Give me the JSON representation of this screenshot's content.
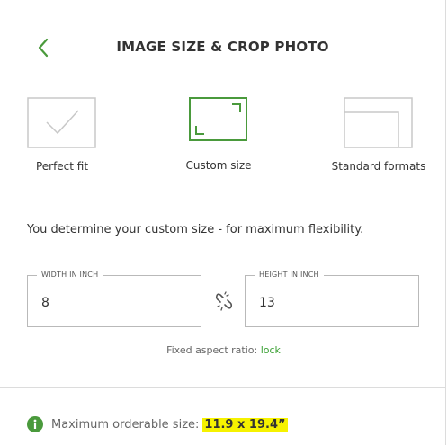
{
  "header": {
    "title": "IMAGE SIZE & CROP PHOTO"
  },
  "options": [
    {
      "label": "Perfect fit",
      "icon": "checkmark-frame-icon",
      "selected": false
    },
    {
      "label": "Custom size",
      "icon": "crop-corners-icon",
      "selected": true
    },
    {
      "label": "Standard formats",
      "icon": "nested-frames-icon",
      "selected": false
    }
  ],
  "intro": "You determine your custom size - for maximum flexibility.",
  "width": {
    "label": "WIDTH IN INCH",
    "value": "8"
  },
  "height": {
    "label": "HEIGHT IN INCH",
    "value": "13"
  },
  "aspect": {
    "label": "Fixed aspect ratio:",
    "action": "lock"
  },
  "max_size": {
    "label": "Maximum orderable size:",
    "value": "11.9 x 19.4”"
  },
  "colors": {
    "accent": "#4a9a3c",
    "link": "#3aa033",
    "highlight": "#f6f200",
    "border": "#b9b9b9"
  }
}
